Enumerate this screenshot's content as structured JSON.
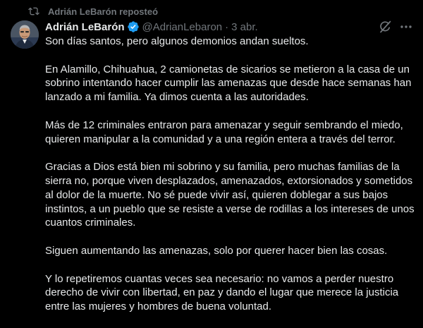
{
  "repost": {
    "label": "Adrián LeBarón reposteó",
    "icon": "repost-icon"
  },
  "author": {
    "name": "Adrián LeBarón",
    "handle": "@AdrianLebaron",
    "separator": "·",
    "date": "3 abr.",
    "verified": true,
    "verified_color": "#1d9bf0"
  },
  "icons": {
    "grok": "grok-icon",
    "more": "more-icon",
    "avatar": "avatar"
  },
  "body": {
    "paragraphs": [
      "Son días santos, pero algunos demonios andan sueltos.",
      "En Alamillo, Chihuahua, 2 camionetas de sicarios se metieron a la casa de un sobrino intentando hacer cumplir las amenazas que desde hace semanas han lanzado a mi familia. Ya dimos cuenta a las autoridades.",
      "Más de 12 criminales entraron para amenazar y seguir sembrando el miedo, quieren manipular a la comunidad y a una región entera a través del terror.",
      "Gracias a Dios está bien mi sobrino y su familia, pero muchas familias de la sierra no, porque viven desplazados, amenazados, extorsionados y sometidos al dolor de la muerte. No sé puede vivir así, quieren doblegar a sus bajos instintos, a un pueblo que se resiste a verse de rodillas a los intereses de unos cuantos criminales.",
      "Siguen aumentando las amenazas, solo por querer hacer bien las cosas.",
      "Y lo repetiremos cuantas veces sea necesario: no vamos a perder nuestro derecho de vivir con libertad, en paz y dando el lugar que merece la justicia entre las mujeres y hombres de buena voluntad."
    ]
  },
  "colors": {
    "background": "#000000",
    "text": "#e7e9ea",
    "secondary": "#71767b",
    "accent": "#1d9bf0"
  }
}
